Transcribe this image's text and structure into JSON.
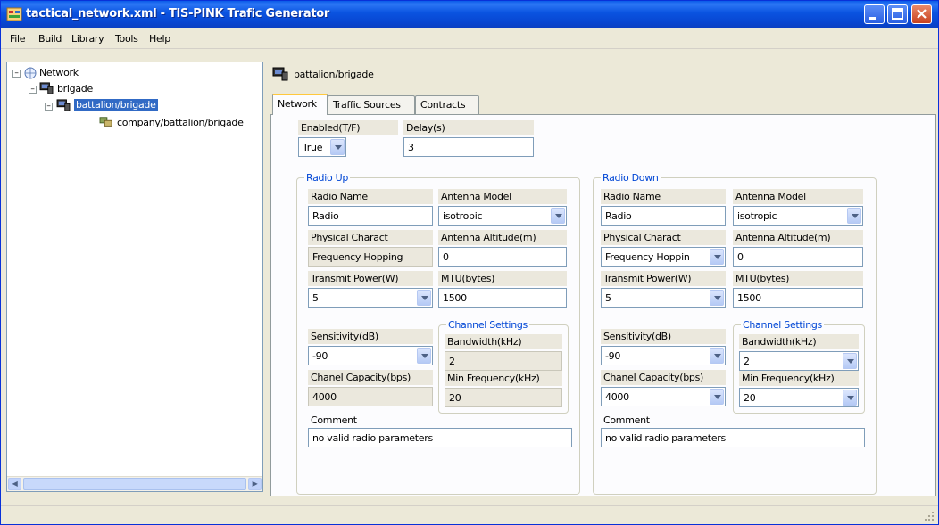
{
  "window": {
    "title": "tactical_network.xml - TIS-PINK Trafic Generator"
  },
  "menu": [
    "File",
    "Build",
    "Library",
    "Tools",
    "Help"
  ],
  "tree": {
    "nodes": [
      {
        "label": "Network",
        "expander": "–"
      },
      {
        "label": "brigade",
        "expander": "–"
      },
      {
        "label": "battalion/brigade",
        "expander": "–",
        "selected": true
      },
      {
        "label": "company/battalion/brigade"
      }
    ]
  },
  "panel": {
    "title": "battalion/brigade",
    "tabs": [
      "Network",
      "Traffic Sources",
      "Contracts"
    ],
    "active_tab": "Network"
  },
  "network": {
    "enabled_label": "Enabled(T/F)",
    "enabled_value": "True",
    "delay_label": "Delay(s)",
    "delay_value": "3"
  },
  "radio_up": {
    "title": "Radio Up",
    "radio_name_label": "Radio Name",
    "radio_name_value": "Radio",
    "antenna_model_label": "Antenna Model",
    "antenna_model_value": "isotropic",
    "physical_charact_label": "Physical Charact",
    "physical_charact_value": "Frequency Hopping",
    "antenna_altitude_label": "Antenna Altitude(m)",
    "antenna_altitude_value": "0",
    "transmit_power_label": "Transmit Power(W)",
    "transmit_power_value": "5",
    "mtu_label": "MTU(bytes)",
    "mtu_value": "1500",
    "sensitivity_label": "Sensitivity(dB)",
    "sensitivity_value": "-90",
    "channel_capacity_label": "Chanel Capacity(bps)",
    "channel_capacity_value": "4000",
    "channel_settings_title": "Channel Settings",
    "bandwidth_label": "Bandwidth(kHz)",
    "bandwidth_value": "2",
    "min_frequency_label": "Min Frequency(kHz)",
    "min_frequency_value": "20",
    "comment_label": "Comment",
    "comment_value": "no valid radio parameters"
  },
  "radio_down": {
    "title": "Radio Down",
    "radio_name_label": "Radio Name",
    "radio_name_value": "Radio",
    "antenna_model_label": "Antenna Model",
    "antenna_model_value": "isotropic",
    "physical_charact_label": "Physical Charact",
    "physical_charact_value": "Frequency Hoppin",
    "antenna_altitude_label": "Antenna Altitude(m)",
    "antenna_altitude_value": "0",
    "transmit_power_label": "Transmit Power(W)",
    "transmit_power_value": "5",
    "mtu_label": "MTU(bytes)",
    "mtu_value": "1500",
    "sensitivity_label": "Sensitivity(dB)",
    "sensitivity_value": "-90",
    "channel_capacity_label": "Chanel Capacity(bps)",
    "channel_capacity_value": "4000",
    "channel_settings_title": "Channel Settings",
    "bandwidth_label": "Bandwidth(kHz)",
    "bandwidth_value": "2",
    "min_frequency_label": "Min Frequency(kHz)",
    "min_frequency_value": "20",
    "comment_label": "Comment",
    "comment_value": "no valid radio parameters"
  },
  "icons": {
    "app": "traffic-generator-icon",
    "network": "network-icon",
    "node": "computer-node-icon",
    "company": "company-group-icon"
  },
  "colors": {
    "title_bar": "#0a53e0",
    "selection": "#316ac5",
    "group_title": "#0046d5",
    "active_tab_accent": "#ffc83c",
    "close_button": "#c8411f"
  }
}
